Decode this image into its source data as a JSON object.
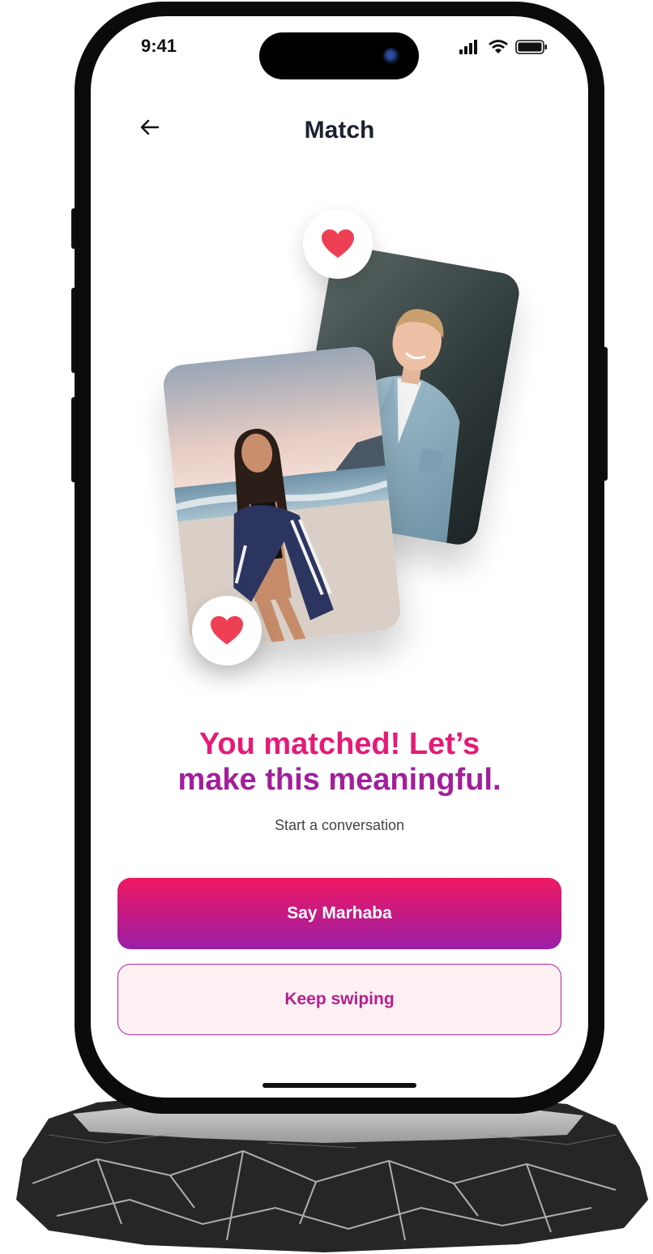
{
  "status_bar": {
    "time": "9:41",
    "signal_icon": "cellular-signal-icon",
    "wifi_icon": "wifi-icon",
    "battery_icon": "battery-icon"
  },
  "header": {
    "title": "Match",
    "back_icon": "arrow-left-icon"
  },
  "photos": [
    {
      "name": "match-photo-man",
      "description_icon": "photo"
    },
    {
      "name": "match-photo-woman",
      "description_icon": "photo"
    }
  ],
  "badges": {
    "icon": "heart-icon",
    "color": "#ee4055"
  },
  "headline": {
    "line1": "You matched! Let’s",
    "line2": "make this meaningful."
  },
  "subtitle": "Start a conversation",
  "actions": {
    "primary_label": "Say Marhaba",
    "secondary_label": "Keep swiping"
  },
  "colors": {
    "accent_pink": "#e51a76",
    "accent_purple": "#a21f9a",
    "secondary_bg": "#fcf0f3"
  }
}
